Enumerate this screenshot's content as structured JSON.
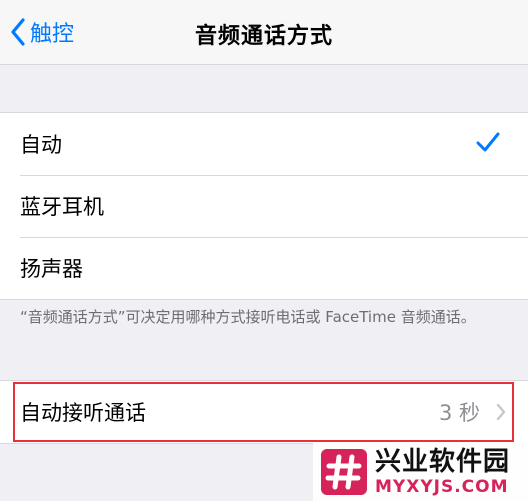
{
  "navbar": {
    "back_label": "触控",
    "title": "音频通话方式"
  },
  "options": [
    {
      "label": "自动",
      "selected": true
    },
    {
      "label": "蓝牙耳机",
      "selected": false
    },
    {
      "label": "扬声器",
      "selected": false
    }
  ],
  "footer_note": "“音频通话方式”可决定用哪种方式接听电话或 FaceTime 音频通话。",
  "auto_answer": {
    "label": "自动接听通话",
    "value": "3 秒"
  },
  "watermark": {
    "name": "兴业软件园",
    "url": "MYXYJS.COM"
  },
  "colors": {
    "accent": "#007aff",
    "highlight_border": "#e8303a",
    "watermark_brand": "#d6245a"
  },
  "icons": {
    "back": "chevron-left-icon",
    "selected": "checkmark-icon",
    "disclosure": "chevron-right-icon"
  }
}
